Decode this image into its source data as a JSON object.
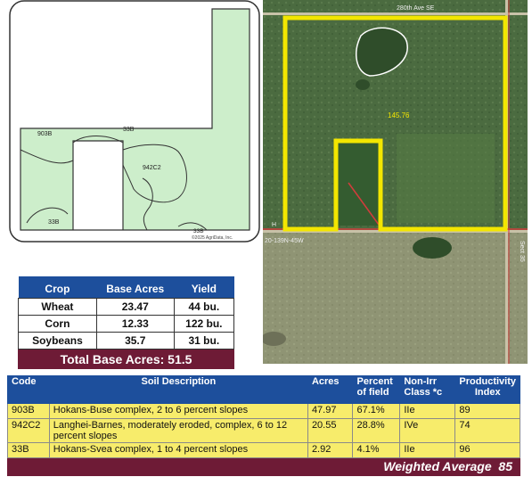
{
  "soil_map": {
    "labels": [
      "903B",
      "33B",
      "942C2",
      "33B",
      "33B"
    ],
    "credit": "©2025 AgriData, Inc."
  },
  "aerial_map": {
    "acres_label": "145.76",
    "road_top": "280th Ave SE",
    "road_left": "20-139N-45W",
    "road_right": "Sect 35",
    "road_h": "H"
  },
  "crop_table": {
    "headers": [
      "Crop",
      "Base Acres",
      "Yield"
    ],
    "rows": [
      {
        "crop": "Wheat",
        "base_acres": "23.47",
        "yield": "44 bu."
      },
      {
        "crop": "Corn",
        "base_acres": "12.33",
        "yield": "122 bu."
      },
      {
        "crop": "Soybeans",
        "base_acres": "35.7",
        "yield": "31 bu."
      }
    ],
    "total_label": "Total Base Acres:",
    "total_value": "51.5"
  },
  "soil_table": {
    "headers": [
      "Code",
      "Soil Description",
      "Acres",
      "Percent of field",
      "Non-Irr Class *c",
      "Productivity Index"
    ],
    "rows": [
      {
        "code": "903B",
        "desc": "Hokans-Buse complex, 2 to 6 percent slopes",
        "acres": "47.97",
        "pct": "67.1%",
        "class": "IIe",
        "pi": "89"
      },
      {
        "code": "942C2",
        "desc": "Langhei-Barnes, moderately eroded, complex, 6 to 12 percent slopes",
        "acres": "20.55",
        "pct": "28.8%",
        "class": "IVe",
        "pi": "74"
      },
      {
        "code": "33B",
        "desc": "Hokans-Svea complex, 1 to 4 percent slopes",
        "acres": "2.92",
        "pct": "4.1%",
        "class": "IIe",
        "pi": "96"
      }
    ],
    "weighted_label": "Weighted Average",
    "weighted_value": "85"
  },
  "colors": {
    "navy": "#1d4f9c",
    "maroon": "#6e1b36",
    "yellow_row": "#f7ec6b",
    "boundary": "#f3e600",
    "soil_fill": "#cdeecb"
  }
}
